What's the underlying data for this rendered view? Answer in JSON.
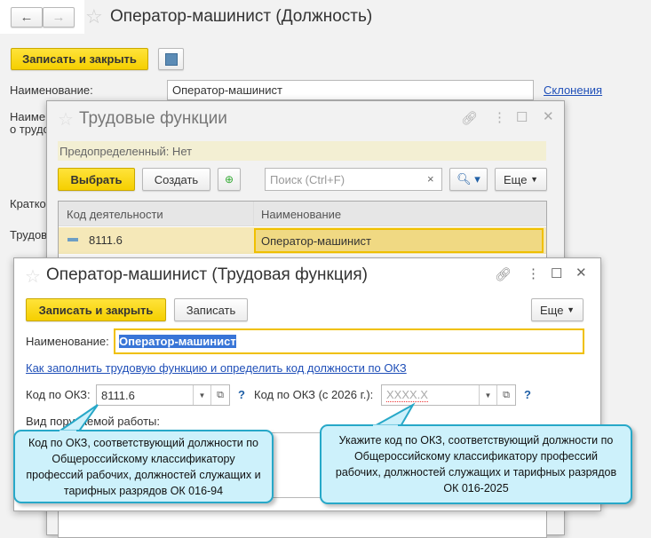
{
  "main": {
    "title": "Оператор-машинист (Должность)",
    "save_close": "Записать и закрыть",
    "name_label": "Наименование:",
    "name_value": "Оператор-машинист",
    "declensions_link": "Склонения",
    "partial_labels": [
      "Наиме",
      "о трудо",
      "Кратко",
      "Трудов"
    ]
  },
  "functions_window": {
    "title": "Трудовые функции",
    "predefined": "Предопределенный: Нет",
    "select": "Выбрать",
    "create": "Создать",
    "search_placeholder": "Поиск (Ctrl+F)",
    "more": "Еще",
    "columns": [
      "Код деятельности",
      "Наименование"
    ],
    "rows": [
      {
        "code": "8111.6",
        "name": "Оператор-машинист"
      }
    ]
  },
  "function_window": {
    "title": "Оператор-машинист (Трудовая функция)",
    "save_close": "Записать и закрыть",
    "save": "Записать",
    "more": "Еще",
    "name_label": "Наименование:",
    "name_value": "Оператор-машинист",
    "help_link": "Как заполнить трудовую функцию и определить код должности по ОКЗ",
    "okz_label": "Код по ОКЗ:",
    "okz_value": "8111.6",
    "okz2026_label": "Код по ОКЗ (с 2026 г.):",
    "okz2026_placeholder": "XXXX.X",
    "help": "?",
    "work_type_label": "Вид поручаемой работы:"
  },
  "callouts": {
    "left": "Код по ОКЗ, соответствующий должности по Общероссийскому классификатору профессий рабочих, должностей служащих и тарифных разрядов ОК 016-94",
    "right": "Укажите код по ОКЗ, соответствующий должности по Общероссийскому классификатору профессий рабочих, должностей служащих и тарифных разрядов ОК 016-2025"
  },
  "colors": {
    "accent_yellow": "#f5cf00",
    "callout_fill": "#cdf1fb",
    "callout_border": "#27a8c8",
    "link": "#1f4fb8"
  }
}
